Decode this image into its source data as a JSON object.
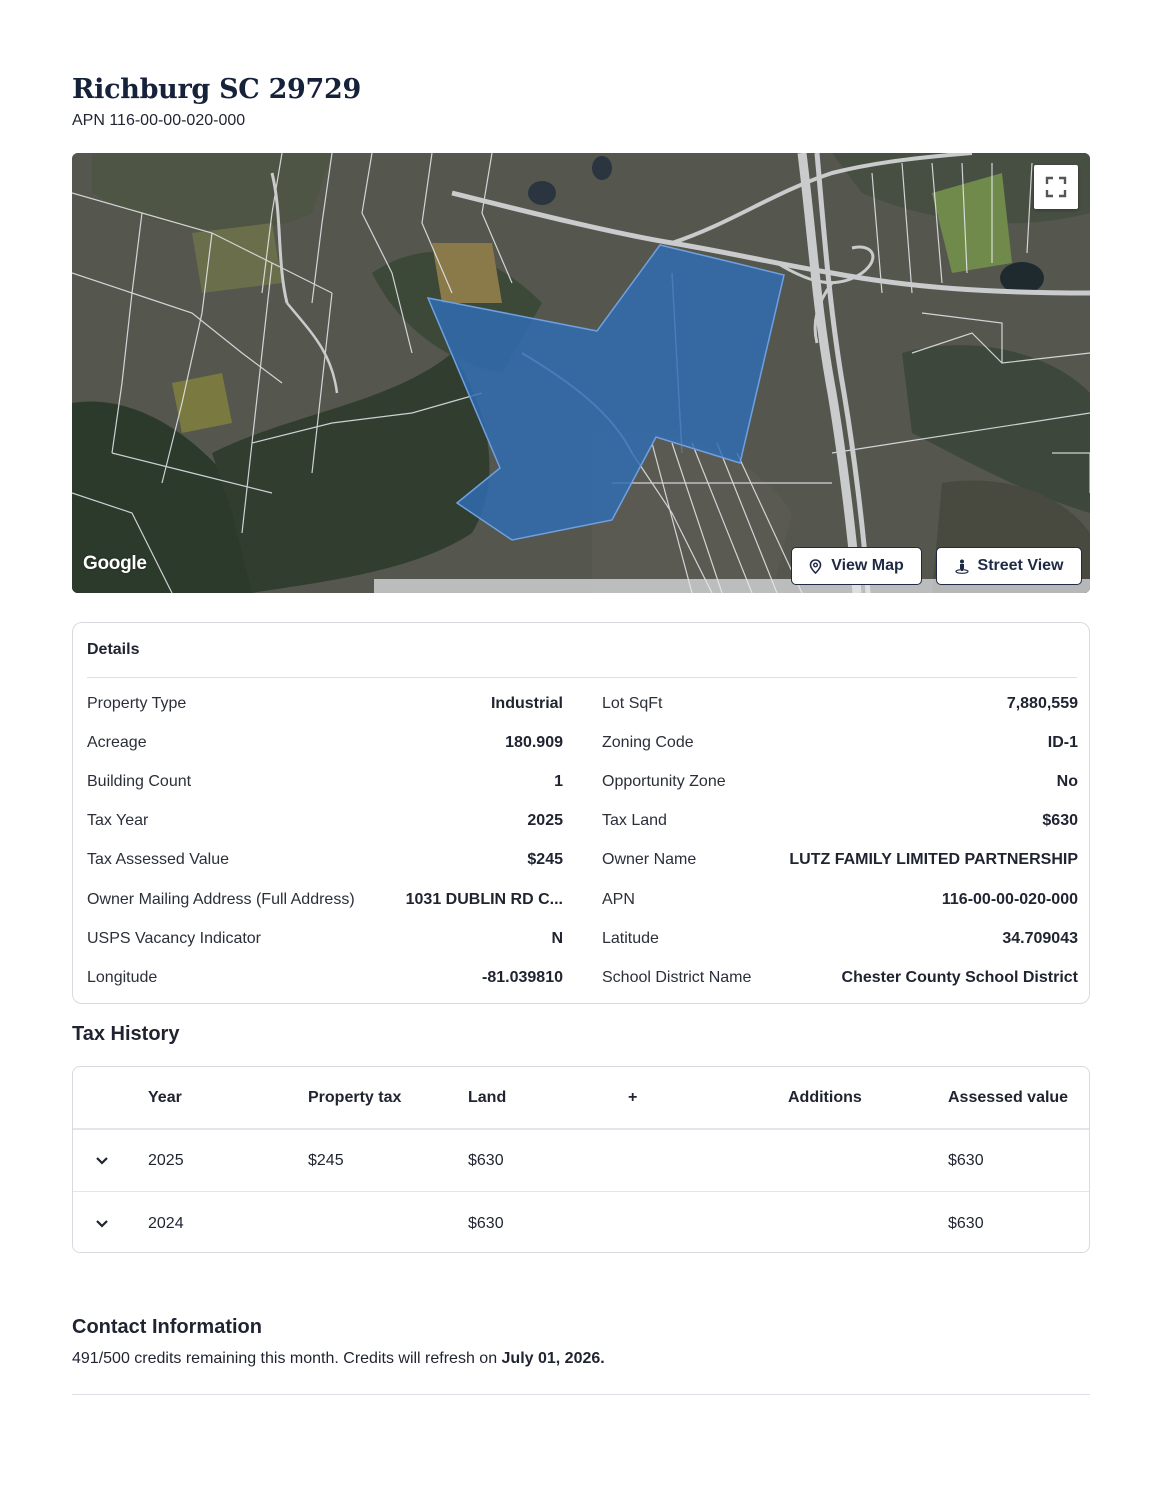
{
  "header": {
    "title": "Richburg SC 29729",
    "apn": "APN 116-00-00-020-000"
  },
  "map": {
    "google_logo": "Google",
    "view_map_label": "View Map",
    "street_view_label": "Street View",
    "parcel_color": "#2f6db5",
    "icons": [
      "fullscreen-icon",
      "map-pin-icon",
      "street-view-person-icon"
    ]
  },
  "details": {
    "heading": "Details",
    "left": [
      {
        "label": "Property Type",
        "value": "Industrial"
      },
      {
        "label": "Acreage",
        "value": "180.909"
      },
      {
        "label": "Building Count",
        "value": "1"
      },
      {
        "label": "Tax Year",
        "value": "2025"
      },
      {
        "label": "Tax Assessed Value",
        "value": "$245"
      },
      {
        "label": "Owner Mailing Address (Full Address)",
        "value": "1031 DUBLIN RD C..."
      },
      {
        "label": "USPS Vacancy Indicator",
        "value": "N"
      },
      {
        "label": "Longitude",
        "value": "-81.039810"
      }
    ],
    "right": [
      {
        "label": "Lot SqFt",
        "value": "7,880,559"
      },
      {
        "label": "Zoning Code",
        "value": "ID-1"
      },
      {
        "label": "Opportunity Zone",
        "value": "No"
      },
      {
        "label": "Tax Land",
        "value": "$630"
      },
      {
        "label": "Owner Name",
        "value": "LUTZ FAMILY LIMITED PARTNERSHIP"
      },
      {
        "label": "APN",
        "value": "116-00-00-020-000"
      },
      {
        "label": "Latitude",
        "value": "34.709043"
      },
      {
        "label": "School District Name",
        "value": "Chester County School District"
      }
    ]
  },
  "tax_history": {
    "title": "Tax History",
    "columns": [
      "Year",
      "Property tax",
      "Land",
      "+",
      "Additions",
      "Assessed value"
    ],
    "rows": [
      {
        "year": "2025",
        "property_tax": "$245",
        "land": "$630",
        "plus": "",
        "additions": "",
        "assessed_value": "$630"
      },
      {
        "year": "2024",
        "property_tax": "",
        "land": "$630",
        "plus": "",
        "additions": "",
        "assessed_value": "$630"
      }
    ]
  },
  "contact": {
    "title": "Contact Information",
    "credits_text": "491/500 credits remaining this month. Credits will refresh on ",
    "refresh_date": "July 01, 2026."
  }
}
